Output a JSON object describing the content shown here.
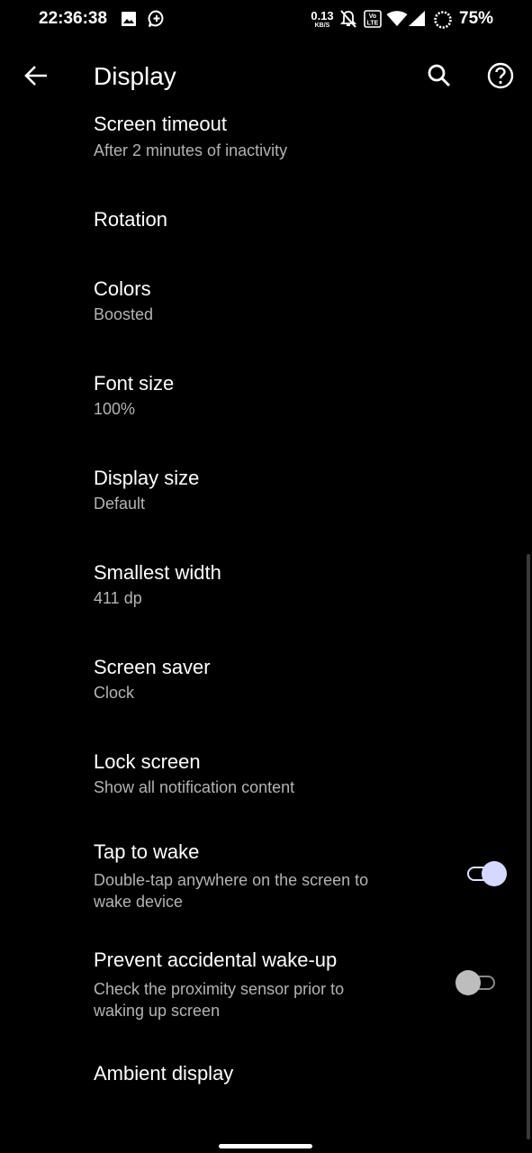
{
  "status_bar": {
    "time": "22:36:38",
    "net_speed_value": "0.13",
    "net_speed_unit": "KB/S",
    "volte_label": "Vo LTE",
    "battery_percent": "75%",
    "icons": [
      "image-icon",
      "messenger-icon",
      "bell-off-icon",
      "volte-icon",
      "wifi-icon",
      "signal-icon",
      "battery-saver-ring-icon"
    ]
  },
  "app_bar": {
    "title": "Display",
    "back_icon": "arrow-back-icon",
    "search_icon": "search-icon",
    "help_icon": "help-icon"
  },
  "settings": [
    {
      "title": "Screen timeout",
      "summary": "After 2 minutes of inactivity"
    },
    {
      "title": "Rotation",
      "summary": ""
    },
    {
      "title": "Colors",
      "summary": "Boosted"
    },
    {
      "title": "Font size",
      "summary": "100%"
    },
    {
      "title": "Display size",
      "summary": "Default"
    },
    {
      "title": "Smallest width",
      "summary": "411 dp"
    },
    {
      "title": "Screen saver",
      "summary": "Clock"
    },
    {
      "title": "Lock screen",
      "summary": "Show all notification content"
    },
    {
      "title": "Tap to wake",
      "summary_line1": "Double-tap anywhere on the screen to",
      "summary_line2": "wake device",
      "toggle": true
    },
    {
      "title": "Prevent accidental wake-up",
      "summary_line1": "Check the proximity sensor prior to",
      "summary_line2": "waking up screen",
      "toggle": false
    },
    {
      "title": "Ambient display",
      "summary": ""
    }
  ],
  "colors": {
    "background": "#000000",
    "text_primary": "#ffffff",
    "text_secondary": "#b3b3b3",
    "toggle_on": "#d5d8ff"
  }
}
